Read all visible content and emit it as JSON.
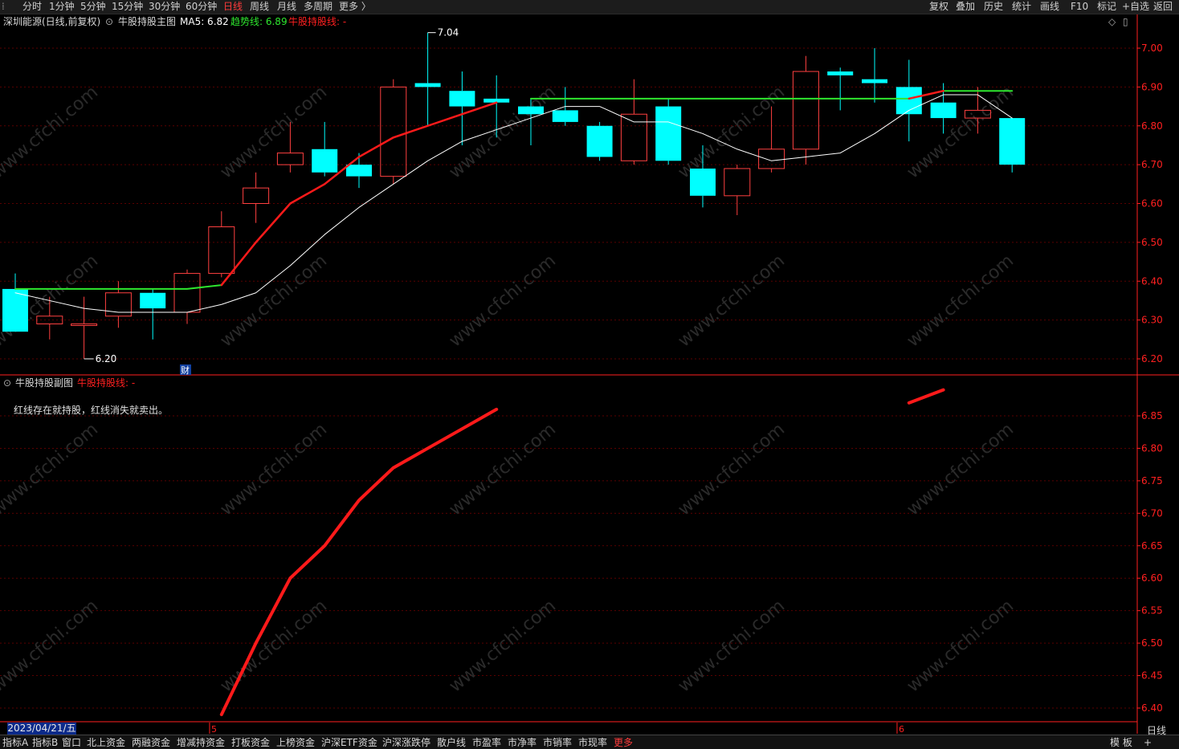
{
  "toolbar": {
    "periods": [
      "分时",
      "1分钟",
      "5分钟",
      "15分钟",
      "30分钟",
      "60分钟",
      "日线",
      "周线",
      "月线",
      "多周期",
      "更多 〉"
    ],
    "active_period": "日线",
    "right_items": [
      "复权",
      "叠加",
      "历史",
      "统计",
      "画线",
      "F10",
      "标记",
      "+自选",
      "返回"
    ]
  },
  "main_header": {
    "stock": "深圳能源(日线,前复权)",
    "indicator": "牛股持股主图",
    "ma5_label": "MA5: 6.82",
    "trend_label": "趋势线: 6.89",
    "holding_label": "牛股持股线: -"
  },
  "sub_header": {
    "indicator": "牛股持股副图",
    "holding_label": "牛股持股线: -",
    "note": "红线存在就持股，红线消失就卖出。"
  },
  "colors": {
    "up": "#ff4040",
    "down": "#00ffff",
    "ma5": "#ffffff",
    "trend": "#2ee62e",
    "holding": "#ff1a1a",
    "axis": "#ff2020",
    "grid": "#5a0000"
  },
  "main_axis_labels": [
    "7.00",
    "6.90",
    "6.80",
    "6.70",
    "6.60",
    "6.50",
    "6.40",
    "6.30",
    "6.20"
  ],
  "sub_axis_labels": [
    "6.85",
    "6.80",
    "6.75",
    "6.70",
    "6.65",
    "6.60",
    "6.55",
    "6.50",
    "6.45",
    "6.40"
  ],
  "annotations": {
    "high": "7.04",
    "low": "6.20",
    "fin_marker": "财"
  },
  "date_box": "2023/04/21/五",
  "month_markers": [
    "5",
    "6"
  ],
  "bottom_tabs": [
    "指标A",
    "指标B",
    "窗口",
    "北上资金",
    "两融资金",
    "增减持资金",
    "打板资金",
    "上榜资金",
    "沪深ETF资金",
    "沪深涨跌停",
    "散户线",
    "市盈率",
    "市净率",
    "市销率",
    "市现率",
    "更多"
  ],
  "bottom_right": [
    "模 板",
    "+"
  ],
  "bottom_period": "日线",
  "watermark": "www.cfchi.com",
  "chart_data": {
    "type": "candlestick",
    "ylim": [
      6.17,
      7.07
    ],
    "candles": [
      {
        "o": 6.38,
        "h": 6.42,
        "l": 6.27,
        "c": 6.27
      },
      {
        "o": 6.29,
        "h": 6.36,
        "l": 6.25,
        "c": 6.31
      },
      {
        "o": 6.29,
        "h": 6.36,
        "l": 6.2,
        "c": 6.29
      },
      {
        "o": 6.31,
        "h": 6.4,
        "l": 6.28,
        "c": 6.37
      },
      {
        "o": 6.37,
        "h": 6.38,
        "l": 6.25,
        "c": 6.33
      },
      {
        "o": 6.32,
        "h": 6.43,
        "l": 6.29,
        "c": 6.42
      },
      {
        "o": 6.42,
        "h": 6.58,
        "l": 6.41,
        "c": 6.54
      },
      {
        "o": 6.6,
        "h": 6.68,
        "l": 6.55,
        "c": 6.64
      },
      {
        "o": 6.7,
        "h": 6.81,
        "l": 6.68,
        "c": 6.73
      },
      {
        "o": 6.74,
        "h": 6.81,
        "l": 6.67,
        "c": 6.68
      },
      {
        "o": 6.7,
        "h": 6.73,
        "l": 6.64,
        "c": 6.67
      },
      {
        "o": 6.67,
        "h": 6.92,
        "l": 6.65,
        "c": 6.9
      },
      {
        "o": 6.91,
        "h": 7.04,
        "l": 6.8,
        "c": 6.9
      },
      {
        "o": 6.89,
        "h": 6.94,
        "l": 6.75,
        "c": 6.85
      },
      {
        "o": 6.87,
        "h": 6.93,
        "l": 6.77,
        "c": 6.86
      },
      {
        "o": 6.85,
        "h": 6.87,
        "l": 6.75,
        "c": 6.83
      },
      {
        "o": 6.84,
        "h": 6.9,
        "l": 6.8,
        "c": 6.81
      },
      {
        "o": 6.8,
        "h": 6.81,
        "l": 6.71,
        "c": 6.72
      },
      {
        "o": 6.71,
        "h": 6.92,
        "l": 6.7,
        "c": 6.83
      },
      {
        "o": 6.85,
        "h": 6.87,
        "l": 6.7,
        "c": 6.71
      },
      {
        "o": 6.69,
        "h": 6.75,
        "l": 6.59,
        "c": 6.62
      },
      {
        "o": 6.62,
        "h": 6.7,
        "l": 6.57,
        "c": 6.69
      },
      {
        "o": 6.69,
        "h": 6.85,
        "l": 6.68,
        "c": 6.74
      },
      {
        "o": 6.74,
        "h": 6.98,
        "l": 6.7,
        "c": 6.94
      },
      {
        "o": 6.94,
        "h": 6.95,
        "l": 6.84,
        "c": 6.93
      },
      {
        "o": 6.92,
        "h": 7.0,
        "l": 6.86,
        "c": 6.91
      },
      {
        "o": 6.9,
        "h": 6.97,
        "l": 6.76,
        "c": 6.83
      },
      {
        "o": 6.86,
        "h": 6.91,
        "l": 6.78,
        "c": 6.82
      },
      {
        "o": 6.82,
        "h": 6.9,
        "l": 6.78,
        "c": 6.84
      },
      {
        "o": 6.82,
        "h": 6.82,
        "l": 6.68,
        "c": 6.7
      }
    ],
    "ma5": [
      6.37,
      6.35,
      6.33,
      6.32,
      6.32,
      6.32,
      6.34,
      6.37,
      6.44,
      6.52,
      6.59,
      6.65,
      6.71,
      6.76,
      6.79,
      6.82,
      6.85,
      6.85,
      6.81,
      6.81,
      6.78,
      6.74,
      6.71,
      6.72,
      6.73,
      6.78,
      6.84,
      6.88,
      6.88,
      6.82
    ],
    "trend": [
      6.38,
      6.38,
      6.38,
      6.38,
      6.38,
      6.38,
      6.39,
      null,
      null,
      null,
      null,
      null,
      null,
      null,
      null,
      6.87,
      6.87,
      6.87,
      6.87,
      6.87,
      6.87,
      6.87,
      6.87,
      6.87,
      6.87,
      6.87,
      6.87,
      6.89,
      6.89,
      6.89
    ],
    "holding": [
      null,
      null,
      null,
      null,
      null,
      null,
      6.39,
      6.5,
      6.6,
      6.65,
      6.72,
      6.77,
      6.8,
      6.83,
      6.86,
      null,
      null,
      null,
      null,
      null,
      null,
      null,
      null,
      null,
      null,
      null,
      6.87,
      6.89,
      null,
      null
    ],
    "sub_ylim": [
      6.39,
      6.895
    ]
  }
}
